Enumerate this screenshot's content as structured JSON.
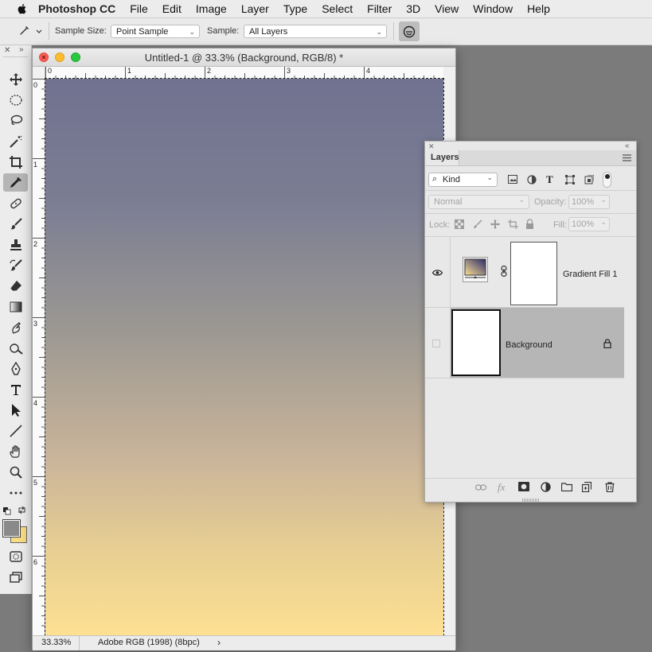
{
  "menubar": {
    "app_name": "Photoshop CC",
    "items": [
      "File",
      "Edit",
      "Image",
      "Layer",
      "Type",
      "Select",
      "Filter",
      "3D",
      "View",
      "Window",
      "Help"
    ]
  },
  "options": {
    "sample_size_label": "Sample Size:",
    "sample_size_value": "Point Sample",
    "sample_label": "Sample:",
    "sample_value": "All Layers"
  },
  "document": {
    "title": "Untitled-1 @ 33.3% (Background, RGB/8) *",
    "hruler_labels": [
      "0",
      "1",
      "2",
      "3",
      "4"
    ],
    "vruler_labels": [
      "0",
      "1",
      "2",
      "3",
      "4",
      "5",
      "6"
    ],
    "zoom": "33.33%",
    "profile": "Adobe RGB (1998) (8bpc)",
    "gradient_top_color": "#717290",
    "gradient_bottom_color": "#fde093"
  },
  "layers_panel": {
    "title": "Layers",
    "filter_kind": "Kind",
    "blend_mode": "Normal",
    "opacity_label": "Opacity:",
    "opacity_value": "100%",
    "lock_label": "Lock:",
    "fill_label": "Fill:",
    "fill_value": "100%",
    "layers": [
      {
        "name": "Gradient Fill 1"
      },
      {
        "name": "Background"
      }
    ]
  },
  "colors": {
    "foreground": "#8a8a8a",
    "background": "#f6dc83"
  }
}
